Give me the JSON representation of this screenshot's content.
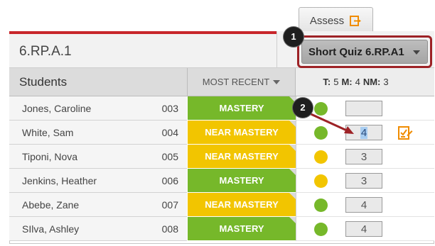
{
  "assess_tab": {
    "label": "Assess",
    "icon": "export-arrow-icon"
  },
  "standard": {
    "title": "6.RP.A.1"
  },
  "quiz_selector": {
    "value": "Short Quiz 6.RP.A1"
  },
  "table_header": {
    "students_label": "Students",
    "recent_label": "MOST RECENT",
    "counts": [
      {
        "key": "T:",
        "value": "5"
      },
      {
        "key": "M:",
        "value": "4"
      },
      {
        "key": "NM:",
        "value": "3"
      }
    ]
  },
  "rows": [
    {
      "name": "Jones, Caroline",
      "number": "003",
      "status": "MASTERY",
      "status_kind": "mastery",
      "dot": "green",
      "score": ""
    },
    {
      "name": "White, Sam",
      "number": "004",
      "status": "NEAR MASTERY",
      "status_kind": "near",
      "dot": "green",
      "score": "4"
    },
    {
      "name": "Tiponi, Nova",
      "number": "005",
      "status": "NEAR MASTERY",
      "status_kind": "near",
      "dot": "yellow",
      "score": "3"
    },
    {
      "name": "Jenkins, Heather",
      "number": "006",
      "status": "MASTERY",
      "status_kind": "mastery",
      "dot": "yellow",
      "score": "3"
    },
    {
      "name": "Abebe, Zane",
      "number": "007",
      "status": "NEAR MASTERY",
      "status_kind": "near",
      "dot": "green",
      "score": "4"
    },
    {
      "name": "SIlva, Ashley",
      "number": "008",
      "status": "MASTERY",
      "status_kind": "mastery",
      "dot": "green",
      "score": "4"
    }
  ],
  "callouts": [
    "1",
    "2"
  ],
  "colors": {
    "accent_red": "#c8262b",
    "callout_border": "#9d2226",
    "mastery_green": "#76b82a",
    "near_mastery_yellow": "#f2c500",
    "edit_orange": "#f08c00"
  }
}
